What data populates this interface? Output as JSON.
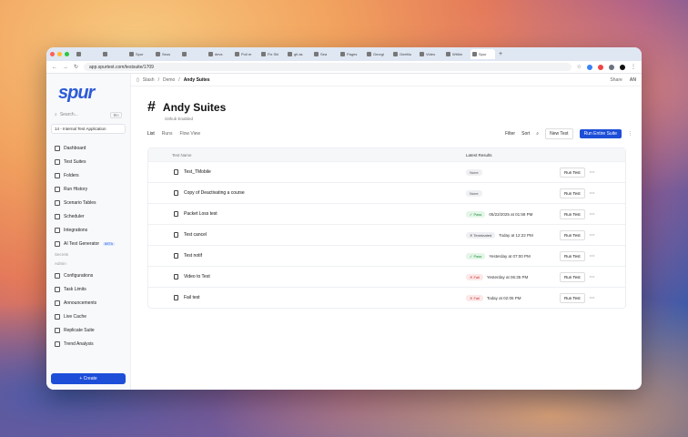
{
  "browser": {
    "tabs": [
      "",
      "",
      "Spur",
      "Seus",
      "",
      "devs",
      "Pull re",
      "Fix Shi",
      "git as",
      "Sea",
      "Pages",
      "Georgi",
      "GeeMu",
      "Video",
      "Within",
      "Spur"
    ],
    "url": "app.spurtest.com/testsuite/1709"
  },
  "sidebar": {
    "logo": "spur",
    "search_placeholder": "Search...",
    "search_kbd": "⌘K",
    "project": "14 - Internal Test Application",
    "items": [
      {
        "label": "Dashboard"
      },
      {
        "label": "Test Suites"
      },
      {
        "label": "Folders"
      },
      {
        "label": "Run History"
      },
      {
        "label": "Scenario Tables"
      },
      {
        "label": "Scheduler"
      },
      {
        "label": "Integrations"
      },
      {
        "label": "AI Test Generator",
        "badge": "BETA"
      }
    ],
    "section_secrets": "Secrets",
    "section_admin": "Admin",
    "admin_items": [
      {
        "label": "Configurations"
      },
      {
        "label": "Task Limits"
      },
      {
        "label": "Announcements"
      },
      {
        "label": "Live Cache"
      },
      {
        "label": "Replicate Suite"
      },
      {
        "label": "Trend Analysis"
      }
    ],
    "create_label": "+ Create"
  },
  "breadcrumb": {
    "root": "Stash",
    "parent": "Demo",
    "current": "Andy Suites",
    "share": "Share",
    "user": "AN"
  },
  "page": {
    "title": "Andy Suites",
    "subtitle": "Github Enabled"
  },
  "toolbar": {
    "views": [
      "List",
      "Runs",
      "Flow View"
    ],
    "filter": "Filter",
    "sort": "Sort",
    "new_test": "New Test",
    "run_suite": "Run Entire Suite"
  },
  "table": {
    "headers": [
      "Test Name",
      "Latest Results"
    ],
    "rows": [
      {
        "name": "Test_TMobile",
        "status": "None",
        "status_kind": "none",
        "time": "",
        "action": "Run Test"
      },
      {
        "name": "Copy of Deactivating a course",
        "status": "None",
        "status_kind": "none",
        "time": "",
        "action": "Run Test"
      },
      {
        "name": "Packet Loss test",
        "status": "✓ Pass",
        "status_kind": "pass",
        "time": "05/22/2025 at 01:58 PM",
        "action": "Run Test"
      },
      {
        "name": "Test cancel",
        "status": "✕ Terminated",
        "status_kind": "term",
        "time": "Today at 12:22 PM",
        "action": "Run Test"
      },
      {
        "name": "Test notif",
        "status": "✓ Pass",
        "status_kind": "pass",
        "time": "Yesterday at 07:00 PM",
        "action": "Run Test"
      },
      {
        "name": "Video to Test",
        "status": "✕ Fail",
        "status_kind": "fail",
        "time": "Yesterday at 06:35 PM",
        "action": "Run Test"
      },
      {
        "name": "Fail test",
        "status": "✕ Fail",
        "status_kind": "fail",
        "time": "Today at 02:05 PM",
        "action": "Run Test"
      }
    ]
  }
}
